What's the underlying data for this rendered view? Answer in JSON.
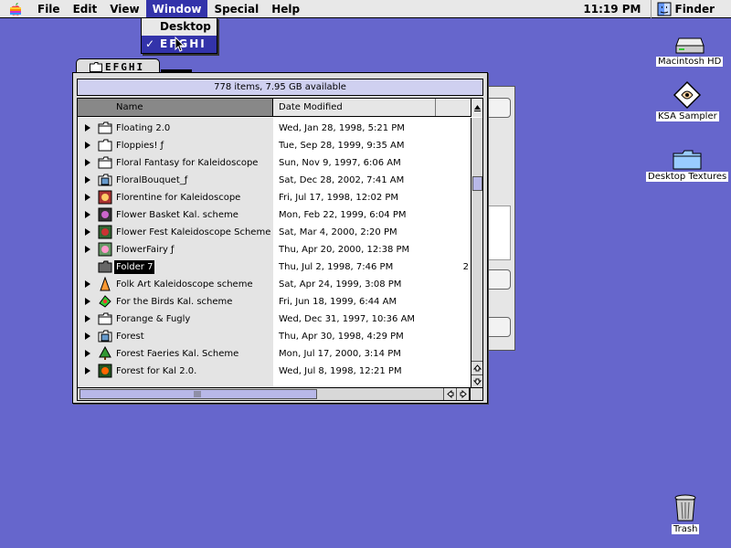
{
  "menubar": {
    "items": [
      "File",
      "Edit",
      "View",
      "Window",
      "Special",
      "Help"
    ],
    "active": "Window",
    "clock": "11:19 PM",
    "app_name": "Finder"
  },
  "window_menu": {
    "items": [
      {
        "label": "Desktop",
        "checked": false
      },
      {
        "label": "EFGHI",
        "checked": true
      }
    ]
  },
  "finder_window": {
    "tab_title": "EFGHI",
    "info": "778 items, 7.95 GB available",
    "columns": {
      "name": "Name",
      "date": "Date Modified"
    },
    "rows": [
      {
        "name": "Floating 2.0",
        "date": "Wed, Jan 28, 1998, 5:21 PM",
        "icon": "folder",
        "disclosure": true
      },
      {
        "name": "Floppies! ƒ",
        "date": "Tue, Sep 28, 1999, 9:35 AM",
        "icon": "folder-white",
        "disclosure": true
      },
      {
        "name": "Floral Fantasy for Kaleidoscope",
        "date": "Sun, Nov 9, 1997, 6:06 AM",
        "icon": "folder",
        "disclosure": true
      },
      {
        "name": "FloralBouquet_ƒ",
        "date": "Sat, Dec 28, 2002, 7:41 AM",
        "icon": "folder-doc",
        "disclosure": true
      },
      {
        "name": "Florentine for Kaleidoscope",
        "date": "Fri, Jul 17, 1998, 12:02 PM",
        "icon": "scheme-red",
        "disclosure": true
      },
      {
        "name": "Flower Basket Kal. scheme",
        "date": "Mon, Feb 22, 1999, 6:04 PM",
        "icon": "scheme-dark",
        "disclosure": true
      },
      {
        "name": "Flower Fest Kaleidoscope Scheme",
        "date": "Sat, Mar 4, 2000, 2:20 PM",
        "icon": "scheme-green",
        "disclosure": true
      },
      {
        "name": "FlowerFairy ƒ",
        "date": "Thu, Apr 20, 2000, 12:38 PM",
        "icon": "scheme-pink",
        "disclosure": true
      },
      {
        "name": "Folder 7",
        "date": "Thu, Jul 2, 1998, 7:46 PM",
        "icon": "folder-dark",
        "disclosure": false,
        "selected": true,
        "extra": "2"
      },
      {
        "name": "Folk Art Kaleidoscope scheme",
        "date": "Sat, Apr 24, 1999, 3:08 PM",
        "icon": "scheme-orange",
        "disclosure": true
      },
      {
        "name": "For the Birds Kal. scheme",
        "date": "Fri, Jun 18, 1999, 6:44 AM",
        "icon": "scheme-bird",
        "disclosure": true
      },
      {
        "name": "Forange & Fugly",
        "date": "Wed, Dec 31, 1997, 10:36 AM",
        "icon": "folder",
        "disclosure": true
      },
      {
        "name": "Forest",
        "date": "Thu, Apr 30, 1998, 4:29 PM",
        "icon": "folder-doc",
        "disclosure": true
      },
      {
        "name": "Forest Faeries Kal. Scheme",
        "date": "Mon, Jul 17, 2000, 3:14 PM",
        "icon": "scheme-tree",
        "disclosure": true
      },
      {
        "name": "Forest for Kal 2.0.",
        "date": "Wed, Jul 8, 1998, 12:21 PM",
        "icon": "scheme-forest",
        "disclosure": true
      }
    ]
  },
  "desktop_icons": [
    {
      "label": "Macintosh HD",
      "icon": "hard-drive-icon"
    },
    {
      "label": "KSA Sampler",
      "icon": "disk-image-icon"
    },
    {
      "label": "Desktop Textures",
      "icon": "folder-icon"
    },
    {
      "label": "Trash",
      "icon": "trash-icon"
    }
  ],
  "colors": {
    "desktop": "#6666cc",
    "menu_highlight": "#3333aa",
    "info_bar": "#cfd0f0",
    "scroll_thumb": "#b8b8e8",
    "name_column_bg": "#e4e4e4"
  }
}
